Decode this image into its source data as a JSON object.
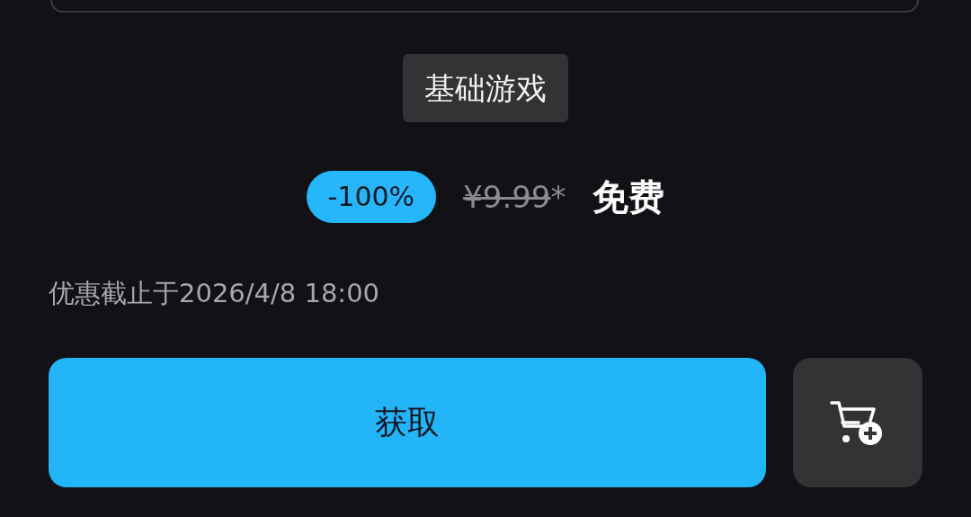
{
  "edition_tag": "基础游戏",
  "price": {
    "discount": "-100%",
    "original_price": "¥9.99",
    "price_note": "*",
    "final_price": "免费"
  },
  "offer_end": "优惠截止于2026/4/8 18:00",
  "actions": {
    "primary": "获取"
  }
}
